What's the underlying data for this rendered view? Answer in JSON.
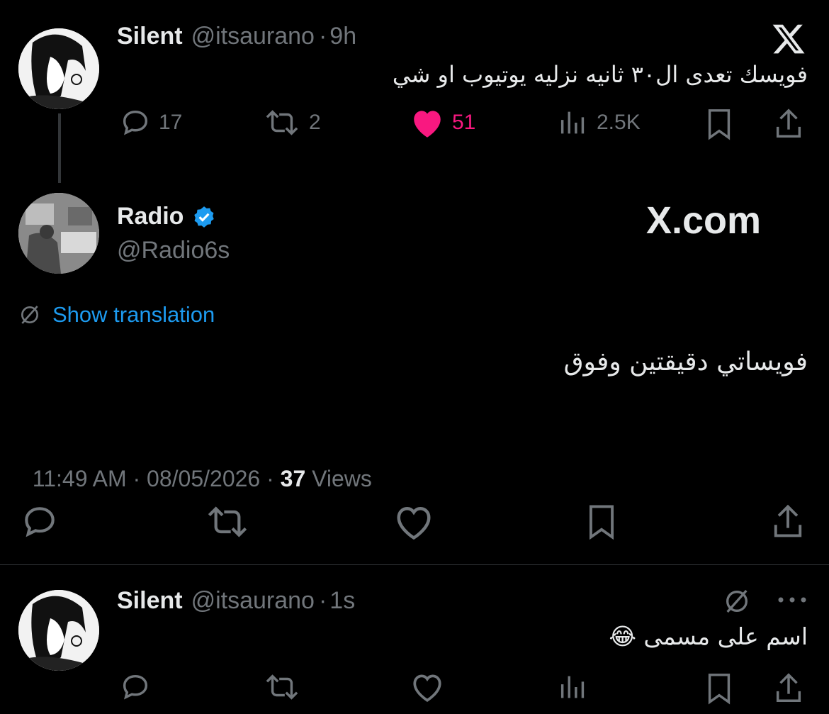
{
  "parent_tweet": {
    "name": "Silent",
    "handle": "@itsaurano",
    "sep": "·",
    "time": "9h",
    "text": "فويسك تعدى ال٣٠ ثانيه نزليه يوتيوب او شي",
    "replies": "17",
    "reposts": "2",
    "likes": "51",
    "views": "2.5K"
  },
  "main_tweet": {
    "name": "Radio",
    "handle": "@Radio6s",
    "watermark": "X.com",
    "show_translation": "Show translation",
    "text": "فويساتي دقيقتين وفوق",
    "timestamp": "11:49 AM · 08/05/2026 · ",
    "views_count": "37",
    "views_label": " Views"
  },
  "reply_tweet": {
    "name": "Silent",
    "handle": "@itsaurano",
    "sep": "·",
    "time": "1s",
    "text": "اسم على مسمى 😂"
  },
  "colors": {
    "background": "#000000",
    "text": "#e7e9ea",
    "muted": "#71767b",
    "like_active": "#f91880",
    "link": "#1d9bf0",
    "verified": "#1d9bf0"
  }
}
